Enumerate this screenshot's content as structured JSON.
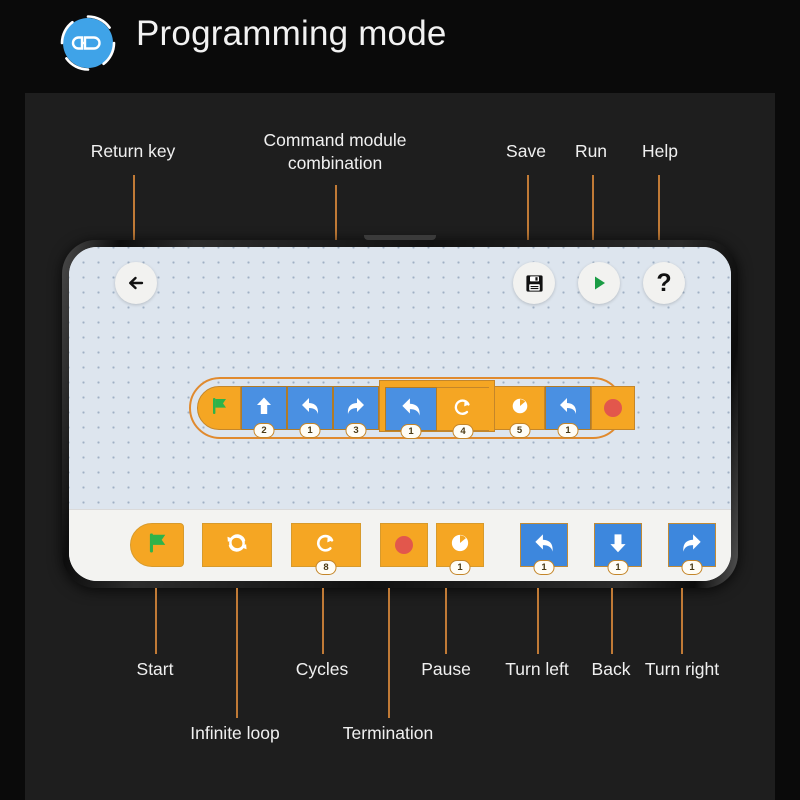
{
  "header": {
    "title": "Programming mode",
    "icon": "programming-mode-icon",
    "icon_color": "#3fa3e8"
  },
  "colors": {
    "page_background": "#0a0a0a",
    "panel_background": "#1e1e1e",
    "leader_line": "#c07a36",
    "block_orange": "#f5a623",
    "block_blue": "#4a90e2",
    "accent_outline": "#e08a2e",
    "flag_green": "#2eb34a",
    "stop_red": "#e2574c",
    "run_green": "#1a9c45",
    "canvas": "#dde5ee",
    "tray": "#f3f3f1"
  },
  "callouts": {
    "top": [
      {
        "label": "Return key",
        "target": "back-button"
      },
      {
        "label": "Command module\ncombination",
        "target": "program-group"
      },
      {
        "label": "Save",
        "target": "save-button"
      },
      {
        "label": "Run",
        "target": "run-button"
      },
      {
        "label": "Help",
        "target": "help-button"
      }
    ],
    "bottom": [
      {
        "label": "Start",
        "target": "palette-start"
      },
      {
        "label": "Infinite loop",
        "target": "palette-infinite-loop"
      },
      {
        "label": "Cycles",
        "target": "palette-cycles"
      },
      {
        "label": "Termination",
        "target": "palette-termination"
      },
      {
        "label": "Pause",
        "target": "palette-pause"
      },
      {
        "label": "Turn left",
        "target": "palette-turn-left"
      },
      {
        "label": "Back",
        "target": "palette-back"
      },
      {
        "label": "Turn right",
        "target": "palette-turn-right"
      }
    ]
  },
  "toolbar": {
    "back_icon": "arrow-left-icon",
    "save_icon": "floppy-disk-icon",
    "run_icon": "play-triangle-icon",
    "help_icon": "question-mark-icon",
    "help_glyph": "?"
  },
  "program": {
    "blocks": [
      {
        "name": "start",
        "icon": "green-flag-icon",
        "kind": "orange",
        "value": ""
      },
      {
        "name": "forward",
        "icon": "arrow-up-icon",
        "kind": "blue",
        "value": "2"
      },
      {
        "name": "turn-left",
        "icon": "arrow-turn-left-icon",
        "kind": "blue",
        "value": "1"
      },
      {
        "name": "turn-right",
        "icon": "arrow-turn-right-icon",
        "kind": "blue",
        "value": "3"
      },
      {
        "name": "turn-left",
        "icon": "arrow-turn-left-icon",
        "kind": "blue",
        "value": "1"
      },
      {
        "name": "cycles",
        "icon": "loop-arrow-icon",
        "kind": "orange",
        "value": "4"
      },
      {
        "name": "pause",
        "icon": "pause-clock-icon",
        "kind": "orange",
        "value": "5"
      },
      {
        "name": "turn-left",
        "icon": "arrow-turn-left-icon",
        "kind": "blue",
        "value": "1"
      },
      {
        "name": "termination",
        "icon": "red-dot-icon",
        "kind": "orange",
        "value": ""
      }
    ]
  },
  "palette": {
    "items": [
      {
        "name": "start",
        "icon": "green-flag-icon",
        "kind": "orange",
        "value": ""
      },
      {
        "name": "infinite-loop",
        "icon": "infinite-loop-icon",
        "kind": "orange",
        "value": ""
      },
      {
        "name": "cycles",
        "icon": "loop-arrow-icon",
        "kind": "orange",
        "value": "8"
      },
      {
        "name": "termination",
        "icon": "red-dot-icon",
        "kind": "orange",
        "value": ""
      },
      {
        "name": "pause",
        "icon": "pause-clock-icon",
        "kind": "orange",
        "value": "1"
      },
      {
        "name": "turn-left",
        "icon": "arrow-turn-left-icon",
        "kind": "blue",
        "value": "1"
      },
      {
        "name": "back",
        "icon": "arrow-down-icon",
        "kind": "blue",
        "value": "1"
      },
      {
        "name": "turn-right",
        "icon": "arrow-turn-right-icon",
        "kind": "blue",
        "value": "1"
      }
    ]
  }
}
